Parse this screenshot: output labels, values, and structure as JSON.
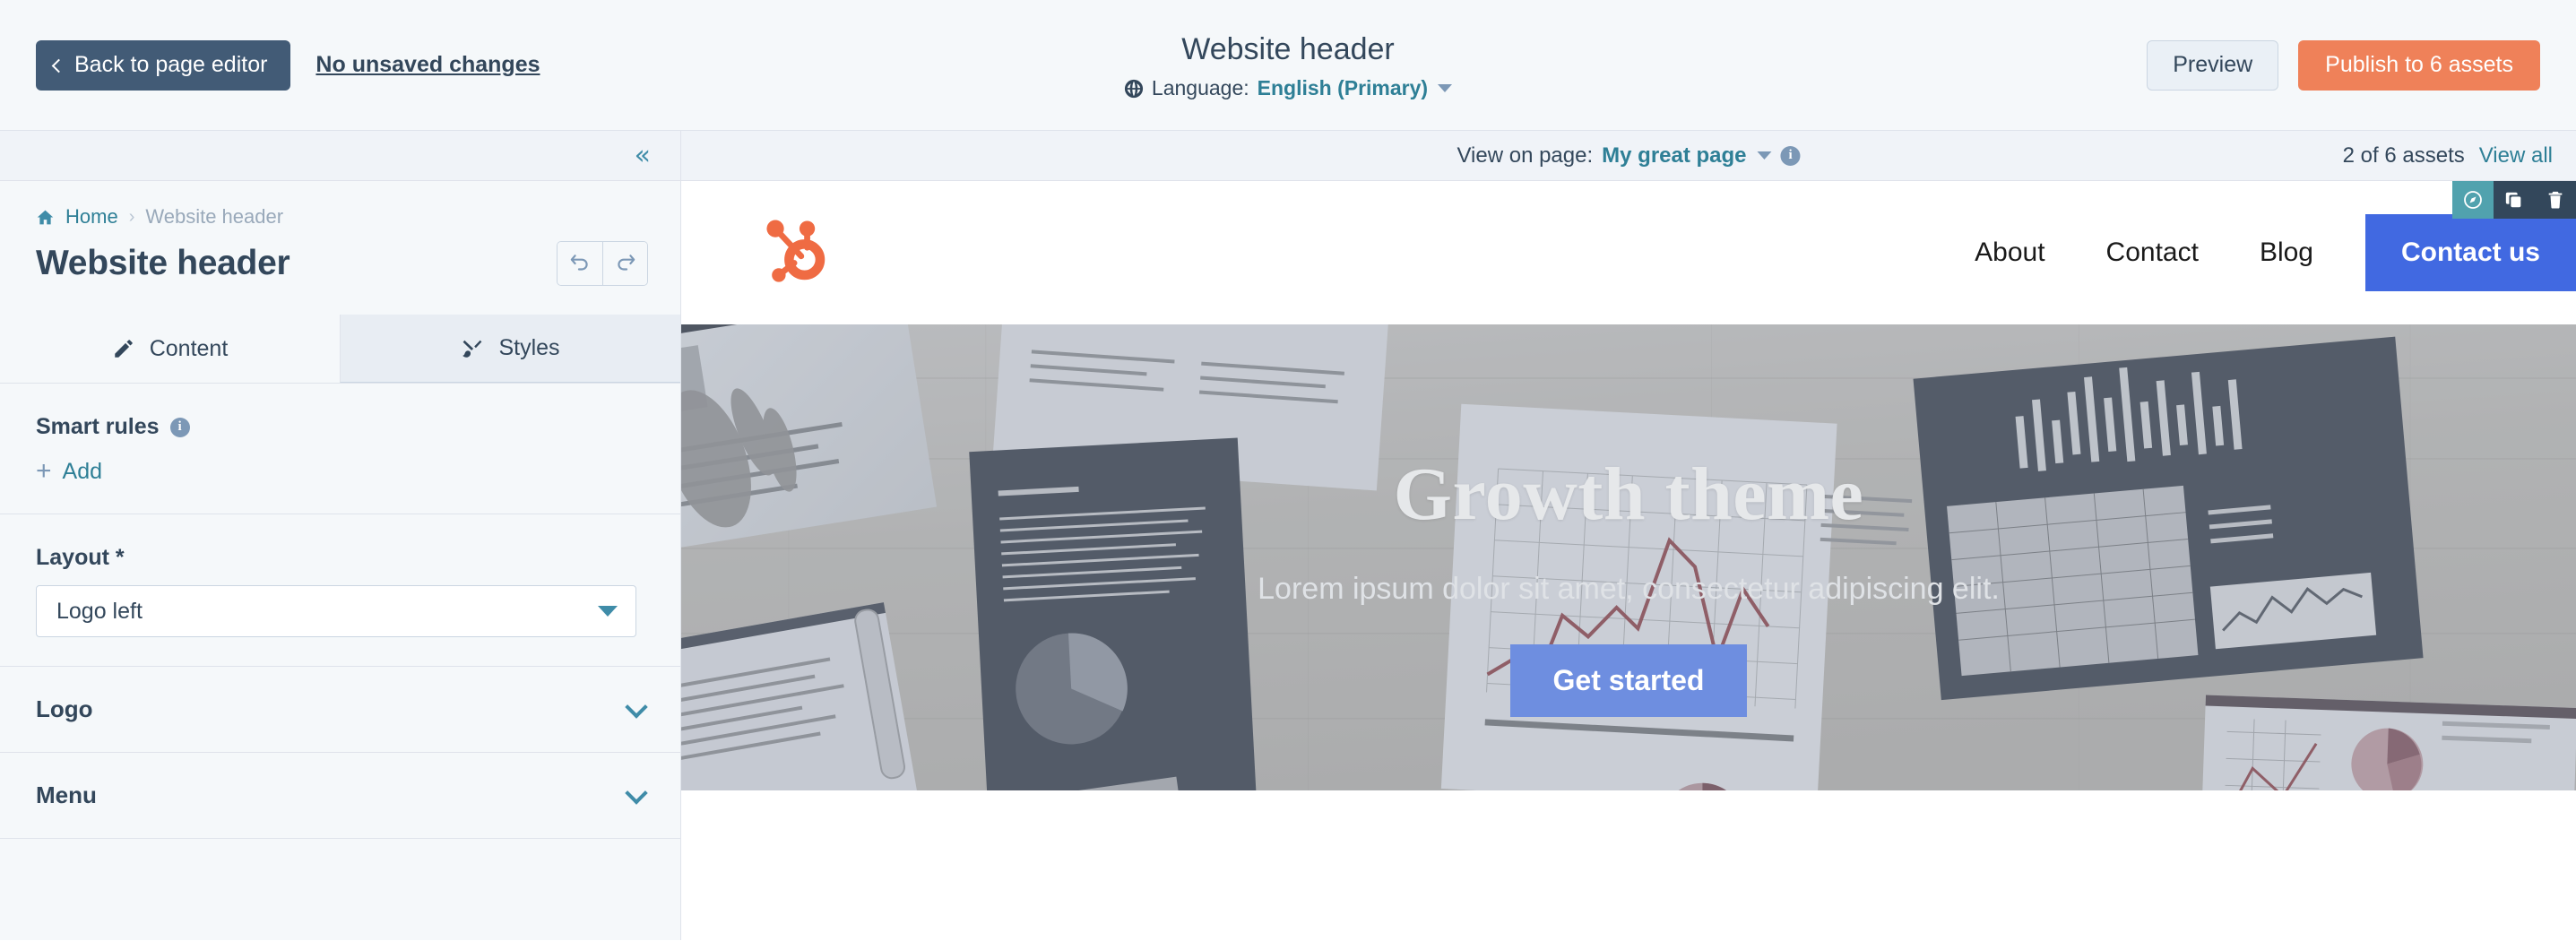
{
  "topbar": {
    "back_label": "Back to page editor",
    "unsaved_label": "No unsaved changes",
    "title": "Website header",
    "language_prefix": "Language:",
    "language_value": "English (Primary)",
    "preview_label": "Preview",
    "publish_label": "Publish to 6 assets",
    "globe_icon": "globe-icon",
    "back_icon": "chevron-left-icon",
    "language_caret_icon": "caret-down-icon"
  },
  "subbar": {
    "collapse_icon": "double-chevron-left-icon",
    "view_on_page_label": "View on page:",
    "view_on_page_value": "My great page",
    "info_icon": "info-icon",
    "info_glyph": "i",
    "assets_count_label": "2 of 6 assets",
    "view_all_label": "View all"
  },
  "sidebar": {
    "breadcrumb": {
      "home_label": "Home",
      "separator": "›",
      "current_label": "Website header"
    },
    "title": "Website header",
    "undo_icon": "undo-icon",
    "redo_icon": "redo-icon",
    "tabs": [
      {
        "label": "Content",
        "icon": "pencil-icon",
        "active": true
      },
      {
        "label": "Styles",
        "icon": "paintbrush-icon",
        "active": false
      }
    ],
    "smart_rules": {
      "label": "Smart rules",
      "info_glyph": "i",
      "info_icon": "info-icon",
      "add_label": "Add",
      "add_icon": "plus-icon"
    },
    "layout_field": {
      "label": "Layout *",
      "value": "Logo left",
      "caret_icon": "caret-down-icon"
    },
    "accordions": [
      {
        "label": "Logo",
        "icon": "chevron-down-icon"
      },
      {
        "label": "Menu",
        "icon": "chevron-down-icon"
      }
    ]
  },
  "preview": {
    "hover_toolbar": [
      {
        "name": "edit-module-button",
        "icon": "compass-icon",
        "accent": true
      },
      {
        "name": "clone-module-button",
        "icon": "copy-icon",
        "accent": false
      },
      {
        "name": "delete-module-button",
        "icon": "trash-icon",
        "accent": false
      }
    ],
    "site_logo_icon": "hubspot-sprocket-logo",
    "nav_links": [
      "About",
      "Contact",
      "Blog"
    ],
    "cta_label": "Contact us",
    "hero": {
      "title": "Growth theme",
      "subtitle": "Lorem ipsum dolor sit amet, consectetur adipiscing elit.",
      "button_label": "Get started"
    }
  },
  "colors": {
    "brand_orange": "#ef8159",
    "teal_link": "#2e7f96",
    "navy": "#33475b",
    "dark_button": "#425b76",
    "cta_blue": "#4169E1",
    "hero_btn_blue": "#6e8ee0",
    "accent_toolbar": "#51a2ae",
    "sidebar_bg": "#f5f8fa",
    "border": "#dfe3eb"
  }
}
